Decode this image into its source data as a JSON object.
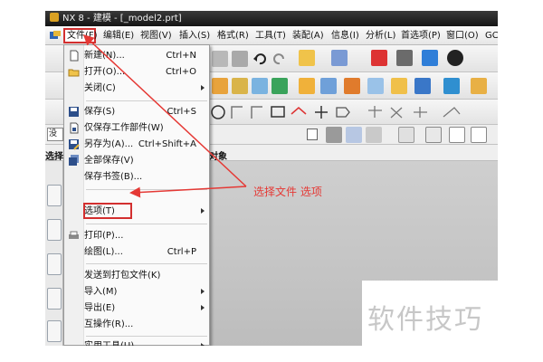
{
  "window": {
    "title": "NX 8 - 建模 - [_model2.prt]"
  },
  "menubar": {
    "items": [
      {
        "label": "文件(F)"
      },
      {
        "label": "编辑(E)"
      },
      {
        "label": "视图(V)"
      },
      {
        "label": "插入(S)"
      },
      {
        "label": "格式(R)"
      },
      {
        "label": "工具(T)"
      },
      {
        "label": "装配(A)"
      },
      {
        "label": "信息(I)"
      },
      {
        "label": "分析(L)"
      },
      {
        "label": "首选项(P)"
      },
      {
        "label": "窗口(O)"
      },
      {
        "label": "GC"
      }
    ]
  },
  "selectbar": {
    "left_label": "选择",
    "object_label": "对象",
    "sel_prefix": "没"
  },
  "file_menu": {
    "items": [
      {
        "label": "新建(N)...",
        "shortcut": "Ctrl+N",
        "icon": "new-file-icon"
      },
      {
        "label": "打开(O)...",
        "shortcut": "Ctrl+O",
        "icon": "open-folder-icon"
      },
      {
        "label": "关闭(C)",
        "shortcut": "",
        "submenu": true
      },
      {
        "label": "保存(S)",
        "shortcut": "Ctrl+S",
        "icon": "save-icon"
      },
      {
        "label": "仅保存工作部件(W)",
        "shortcut": "",
        "icon": "save-work-part-icon"
      },
      {
        "label": "另存为(A)...",
        "shortcut": "Ctrl+Shift+A",
        "icon": "save-as-icon"
      },
      {
        "label": "全部保存(V)",
        "shortcut": "",
        "icon": "save-all-icon"
      },
      {
        "label": "保存书签(B)...",
        "shortcut": ""
      },
      {
        "label": "选项(T)",
        "shortcut": "",
        "submenu": true
      },
      {
        "label": "打印(P)...",
        "shortcut": "",
        "icon": "print-icon"
      },
      {
        "label": "绘图(L)...",
        "shortcut": "Ctrl+P"
      },
      {
        "label": "发送到打包文件(K)",
        "shortcut": ""
      },
      {
        "label": "导入(M)",
        "shortcut": "",
        "submenu": true
      },
      {
        "label": "导出(E)",
        "shortcut": "",
        "submenu": true
      },
      {
        "label": "互操作(R)...",
        "shortcut": ""
      },
      {
        "label": "实用工具(U)",
        "shortcut": "",
        "submenu": true
      }
    ]
  },
  "annotation": {
    "text": "选择文件 选项",
    "color": "#e53935"
  },
  "watermark": {
    "text": "软件技巧"
  }
}
